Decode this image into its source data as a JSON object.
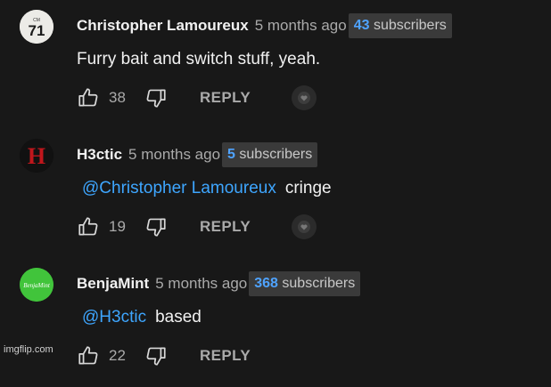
{
  "comments": [
    {
      "author": "Christopher Lamoureux",
      "avatar_label": "71",
      "time": "5 months ago",
      "subscriber_count": "43",
      "subscriber_label": "subscribers",
      "mention": "",
      "text": "Furry bait and switch stuff, yeah.",
      "likes": "38",
      "reply_label": "REPLY"
    },
    {
      "author": "H3ctic",
      "avatar_label": "H",
      "time": "5 months ago",
      "subscriber_count": "5",
      "subscriber_label": "subscribers",
      "mention": "@Christopher Lamoureux",
      "text": "cringe",
      "likes": "19",
      "reply_label": "REPLY"
    },
    {
      "author": "BenjaMint",
      "avatar_label": "BenjaMint",
      "time": "5 months ago",
      "subscriber_count": "368",
      "subscriber_label": "subscribers",
      "mention": "@H3ctic",
      "text": "based",
      "likes": "22",
      "reply_label": "REPLY"
    }
  ],
  "watermark": "imgflip.com",
  "colors": {
    "background": "#181818",
    "mention": "#3ea6ff",
    "subscriber_count": "#4fa3ff"
  },
  "icons": [
    "thumbs-up-icon",
    "thumbs-down-icon",
    "creator-heart-icon"
  ]
}
